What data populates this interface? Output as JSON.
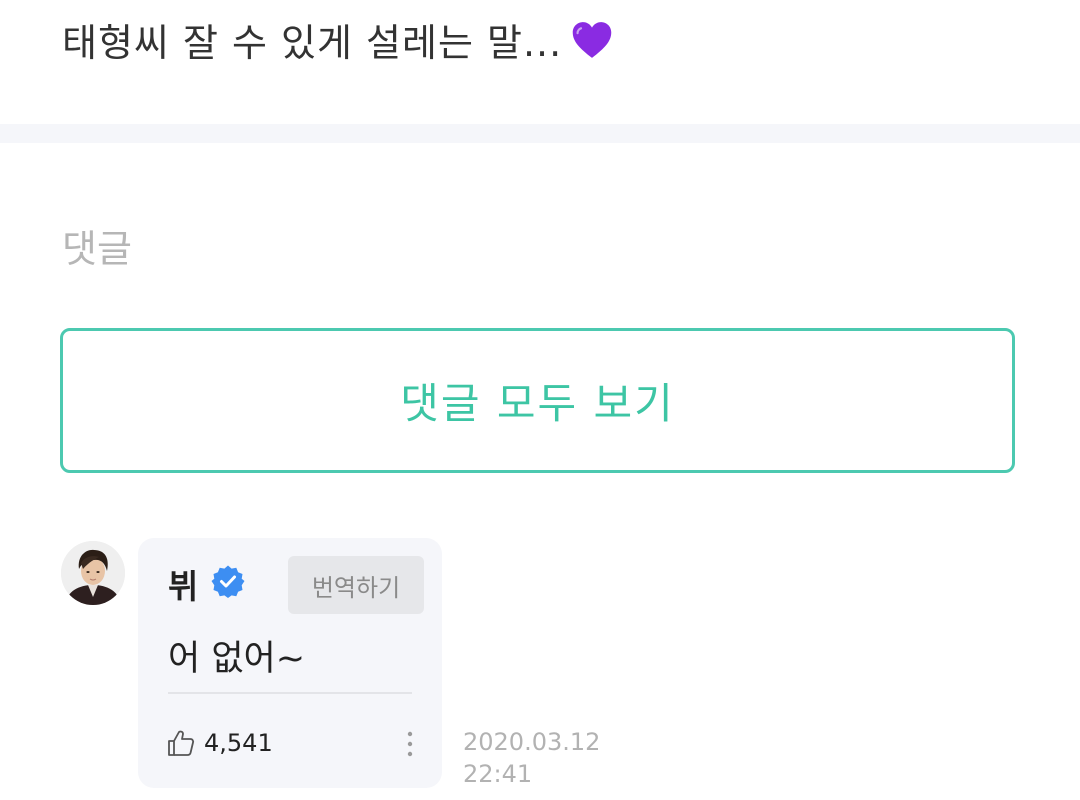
{
  "post": {
    "text": "태형씨 잘 수 있게 설레는 말...",
    "emoji_icon": "purple-heart-icon",
    "emoji_color": "#8a2be2"
  },
  "comments_section": {
    "heading": "댓글",
    "view_all_label": "댓글 모두 보기",
    "accent_color": "#4cc9b0"
  },
  "comment": {
    "author": "뷔",
    "verified_icon": "verified-badge-icon",
    "verified_color": "#3d8ef2",
    "translate_label": "번역하기",
    "body": "어 없어~",
    "like_icon": "thumbs-up-icon",
    "like_count": "4,541",
    "more_icon": "more-vertical-icon",
    "date": "2020.03.12",
    "time": "22:41"
  }
}
